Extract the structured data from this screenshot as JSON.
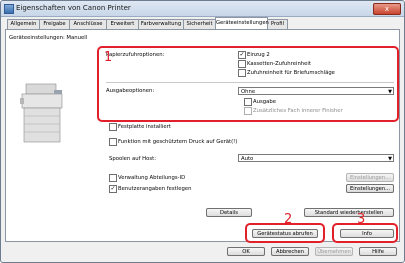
{
  "window": {
    "title": "Eigenschaften von Canon Printer",
    "close_label": "x"
  },
  "tabs": [
    {
      "label": "Allgemein"
    },
    {
      "label": "Freigabe"
    },
    {
      "label": "Anschlüsse"
    },
    {
      "label": "Erweitert"
    },
    {
      "label": "Farbverwaltung"
    },
    {
      "label": "Sicherheit"
    },
    {
      "label": "Geräteeinstellungen"
    },
    {
      "label": "Profil"
    }
  ],
  "active_tab": "Geräteeinstellungen",
  "panel": {
    "header": "Geräteeinstellungen: Manuell",
    "paper_feed_label": "Papierzufuhroptionen:",
    "paper_feed_options": [
      {
        "label": "Einzug 2",
        "checked": true
      },
      {
        "label": "Kassetten-Zufuhreinheit",
        "checked": false
      },
      {
        "label": "Zufuhreinheit für Briefumschläge",
        "checked": false
      }
    ],
    "output_label": "Ausgabeoptionen:",
    "output_value": "Ohne",
    "output_sub": [
      {
        "label": "Ausgabe",
        "checked": false,
        "disabled": false
      },
      {
        "label": "Zusätzliches Fach innerer Finisher",
        "checked": false,
        "disabled": true
      }
    ],
    "hard_disk_label": "Festplatte installiert",
    "secure_print_label": "Funktion mit geschütztem Druck auf Gerät(!)",
    "spool_label": "Spoolen auf Host:",
    "spool_value": "Auto",
    "dept_id_label": "Verwaltung Abteilungs-ID",
    "dept_settings_button": "Einstellungen...",
    "user_info_label": "Benutzerangaben festlegen",
    "user_settings_button": "Einstellungen...",
    "details_button": "Details",
    "restore_button": "Standard wiederherstellen",
    "get_status_button": "Gerätestatus abrufen",
    "info_button": "Info"
  },
  "footer": {
    "ok": "OK",
    "cancel": "Abbrechen",
    "apply": "Übernehmen",
    "help": "Hilfe"
  },
  "annotations": [
    {
      "number": "1"
    },
    {
      "number": "2"
    },
    {
      "number": "3"
    }
  ],
  "colors": {
    "annotation": "#e2202a",
    "active_tab_bg": "#ffffff"
  }
}
